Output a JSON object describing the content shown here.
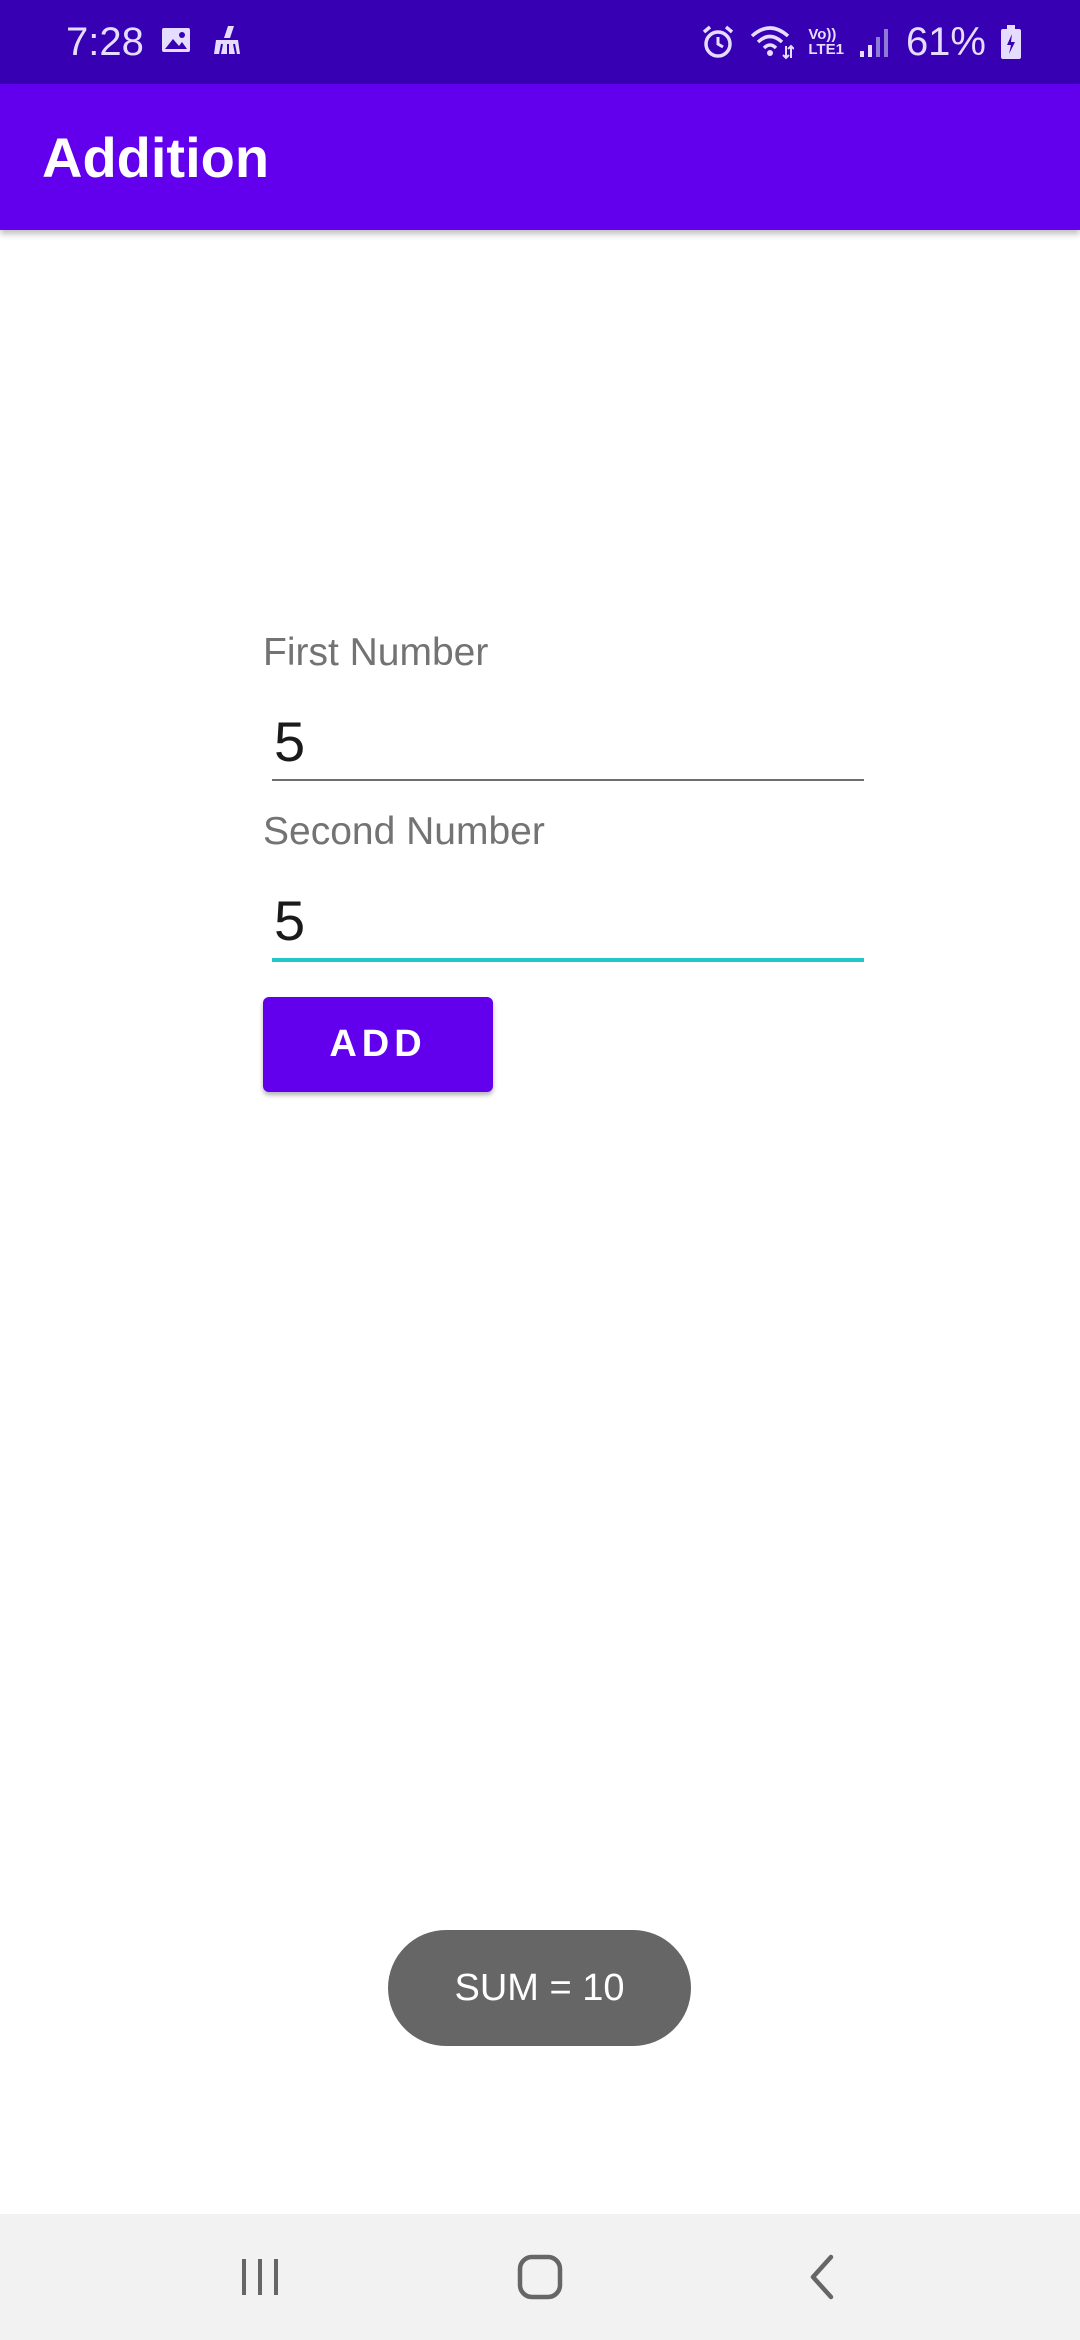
{
  "status_bar": {
    "time": "7:28",
    "battery": "61%",
    "left_icons": [
      "image-icon",
      "cleaner-icon"
    ],
    "right_icons": [
      "alarm-icon",
      "wifi-icon",
      "volte-icon",
      "signal-icon",
      "battery-icon"
    ],
    "volte_line1": "Vo))",
    "volte_line2": "LTE1"
  },
  "app_bar": {
    "title": "Addition"
  },
  "form": {
    "first": {
      "label": "First Number",
      "value": "5"
    },
    "second": {
      "label": "Second Number",
      "value": "5"
    },
    "add_button_label": "ADD"
  },
  "toast": {
    "text": "SUM = 10"
  },
  "nav_bar": {
    "buttons": [
      "recents-icon",
      "home-icon",
      "back-icon"
    ]
  },
  "colors": {
    "status_bar": "#3700b3",
    "primary": "#6200ee",
    "focus_underline": "#26c6c6",
    "toast_bg": "#666666"
  }
}
